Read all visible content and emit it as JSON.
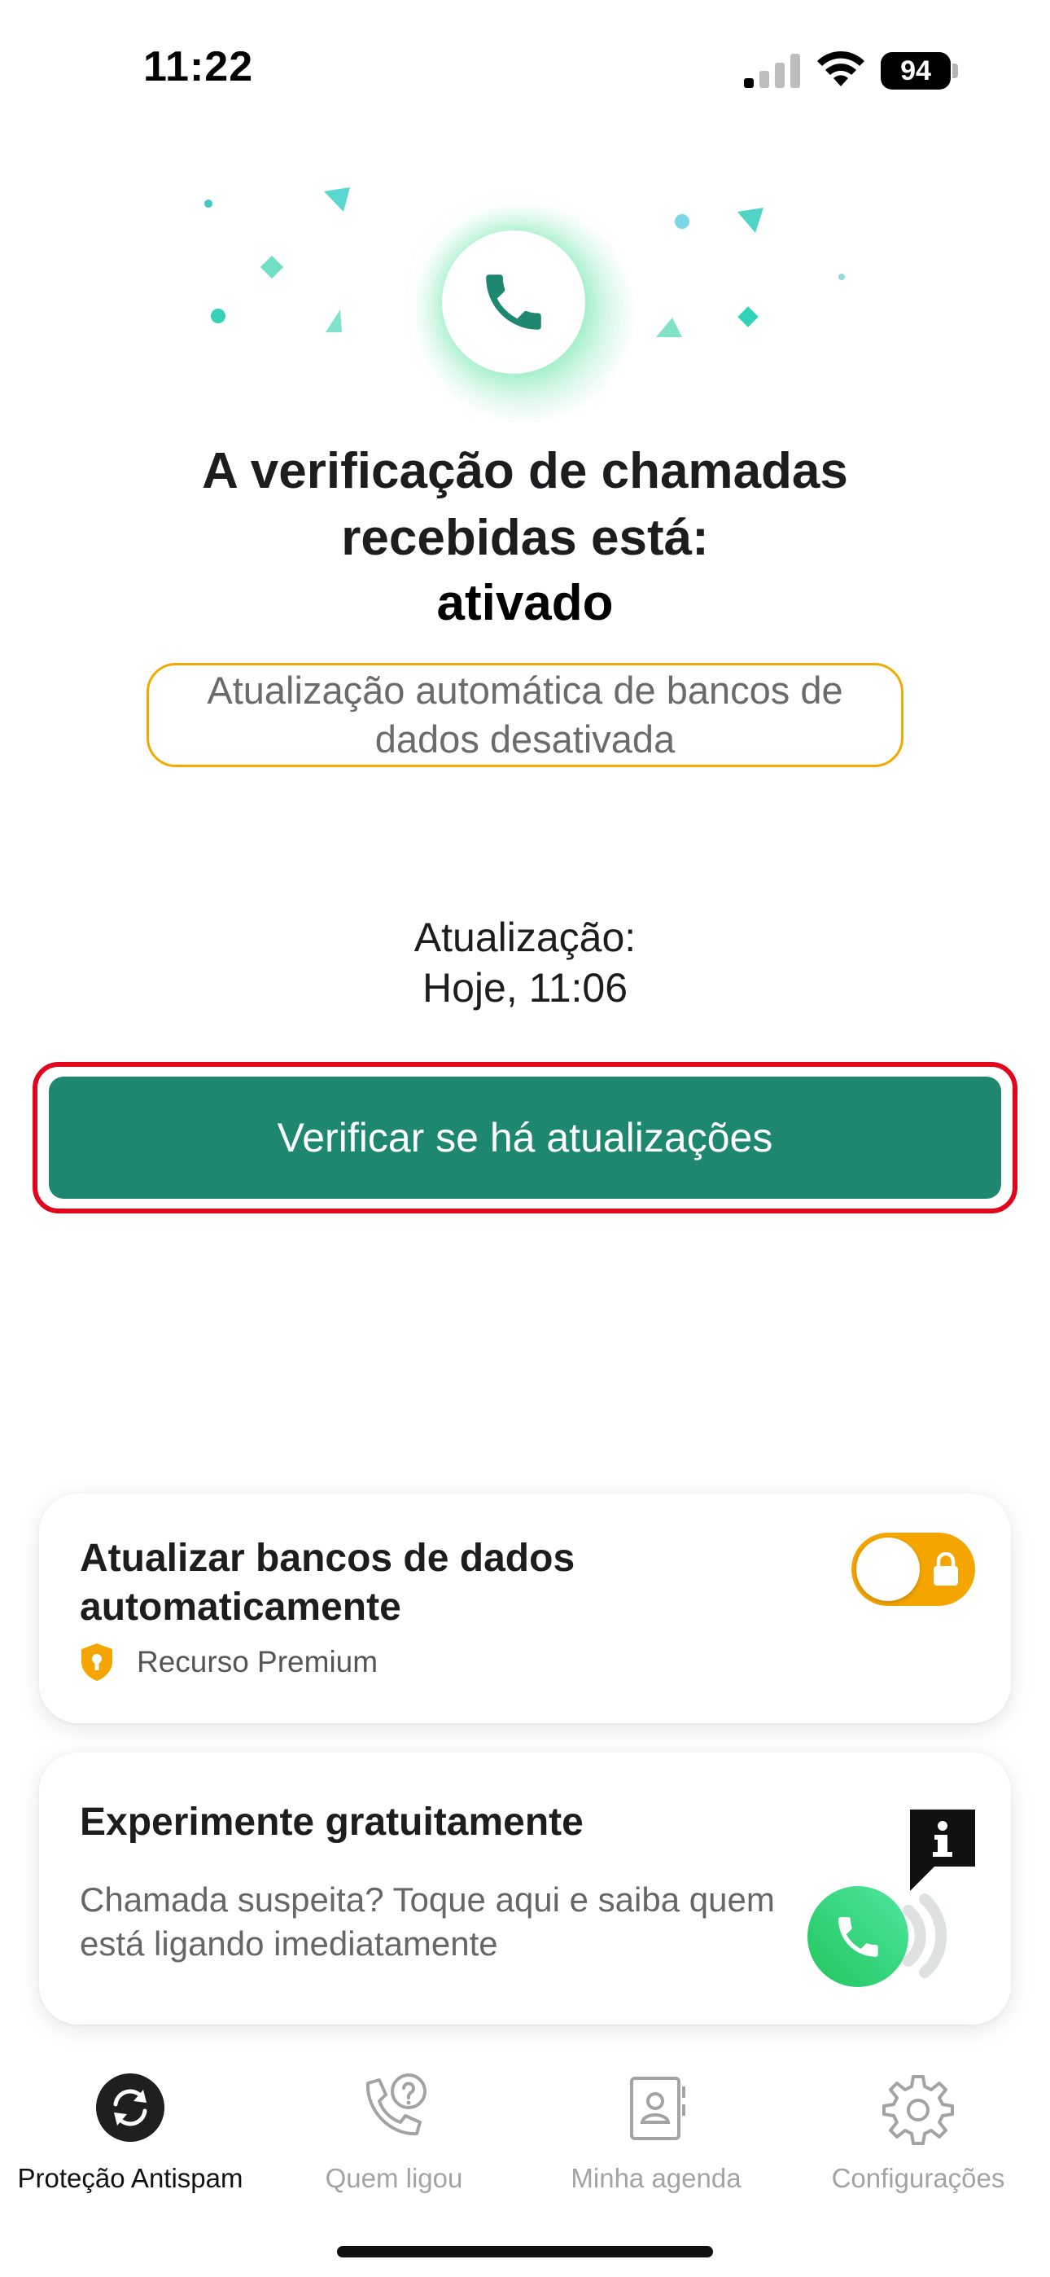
{
  "status_bar": {
    "time": "11:22",
    "battery": "94",
    "icons": [
      "signal-icon",
      "wifi-icon",
      "battery-icon"
    ]
  },
  "hero": {
    "icon": "phone-icon",
    "title": "A verificação de chamadas recebidas está:",
    "state": "ativado"
  },
  "warning": {
    "text": "Atualização automática de bancos de dados desativada"
  },
  "update": {
    "label": "Atualização:",
    "time": "Hoje, 11:06"
  },
  "check_button": {
    "label": "Verificar se há atualizações"
  },
  "auto_update_card": {
    "title": "Atualizar bancos de dados automaticamente",
    "premium_label": "Recurso Premium",
    "toggle_on": false,
    "locked": true
  },
  "trial_card": {
    "title": "Experimente gratuitamente",
    "description": "Chamada suspeita? Toque aqui e saiba quem está ligando imediatamente"
  },
  "tabbar": {
    "tabs": [
      {
        "label": "Proteção Antispam",
        "icon": "sync-icon",
        "active": true
      },
      {
        "label": "Quem ligou",
        "icon": "phone-question-icon",
        "active": false
      },
      {
        "label": "Minha agenda",
        "icon": "contacts-book-icon",
        "active": false
      },
      {
        "label": "Configurações",
        "icon": "gear-icon",
        "active": false
      }
    ]
  },
  "colors": {
    "accent_green": "#1e8770",
    "warning_orange": "#f2a900",
    "highlight_red": "#e1061b",
    "toggle_orange": "#f5a500"
  }
}
